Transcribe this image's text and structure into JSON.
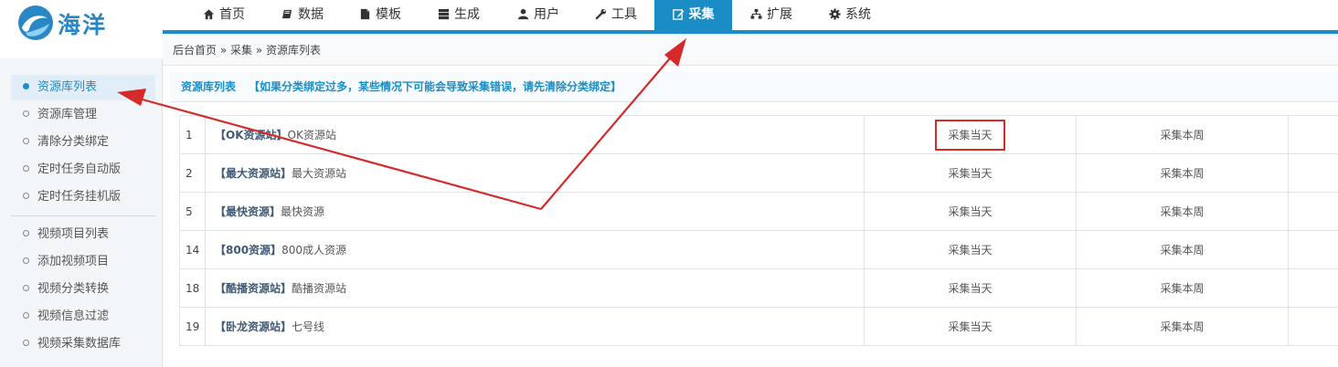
{
  "brand": {
    "name": "海洋"
  },
  "nav": {
    "items": [
      {
        "label": "首页",
        "icon": "home-icon"
      },
      {
        "label": "数据",
        "icon": "book-icon"
      },
      {
        "label": "模板",
        "icon": "file-icon"
      },
      {
        "label": "生成",
        "icon": "server-icon"
      },
      {
        "label": "用户",
        "icon": "user-icon"
      },
      {
        "label": "工具",
        "icon": "wrench-icon"
      },
      {
        "label": "采集",
        "icon": "edit-icon",
        "active": true
      },
      {
        "label": "扩展",
        "icon": "sitemap-icon"
      },
      {
        "label": "系统",
        "icon": "gear-icon"
      }
    ]
  },
  "breadcrumb": {
    "text": "后台首页 » 采集 » 资源库列表"
  },
  "sidebar": {
    "items": [
      {
        "label": "资源库列表",
        "active": true
      },
      {
        "label": "资源库管理"
      },
      {
        "label": "清除分类绑定"
      },
      {
        "label": "定时任务自动版"
      },
      {
        "label": "定时任务挂机版"
      },
      {
        "label": "视频项目列表"
      },
      {
        "label": "添加视频项目"
      },
      {
        "label": "视频分类转换"
      },
      {
        "label": "视频信息过滤"
      },
      {
        "label": "视频采集数据库"
      }
    ]
  },
  "panel": {
    "title": "资源库列表",
    "notice": "【如果分类绑定过多，某些情况下可能会导致采集错误，请先清除分类绑定】"
  },
  "table": {
    "rows": [
      {
        "id": "1",
        "tag": "【OK资源站】",
        "name": "OK资源站",
        "day": "采集当天",
        "week": "采集本周"
      },
      {
        "id": "2",
        "tag": "【最大资源站】",
        "name": "最大资源站",
        "day": "采集当天",
        "week": "采集本周"
      },
      {
        "id": "5",
        "tag": "【最快资源】",
        "name": "最快资源",
        "day": "采集当天",
        "week": "采集本周"
      },
      {
        "id": "14",
        "tag": "【800资源】",
        "name": "800成人资源",
        "day": "采集当天",
        "week": "采集本周"
      },
      {
        "id": "18",
        "tag": "【酷播资源站】",
        "name": "酷播资源站",
        "day": "采集当天",
        "week": "采集本周"
      },
      {
        "id": "19",
        "tag": "【卧龙资源站】",
        "name": "七号线",
        "day": "采集当天",
        "week": "采集本周"
      }
    ]
  },
  "colors": {
    "accent": "#1a8dc7",
    "annotation": "#d62a2a"
  }
}
